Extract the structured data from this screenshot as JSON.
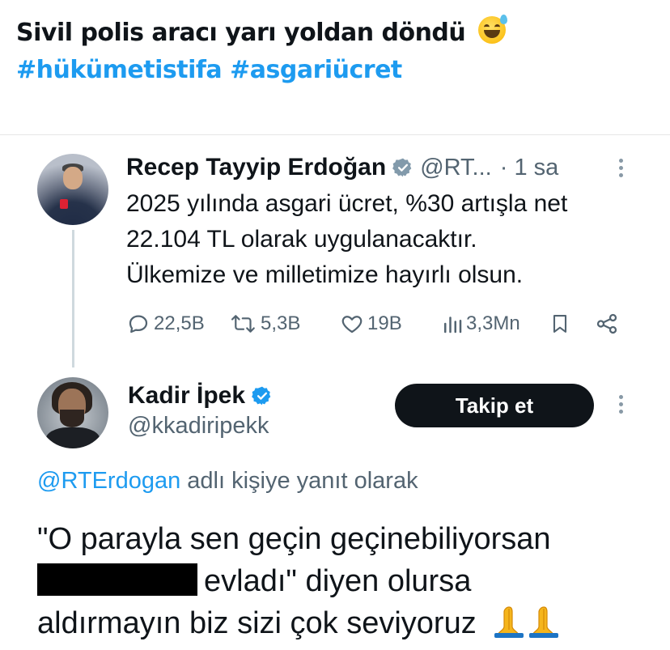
{
  "post": {
    "text": "Sivil polis aracı yarı yoldan döndü",
    "emoji": "grinning-face-with-sweat",
    "hashtags": "#hükümetistifa #asgariücret"
  },
  "quoted_tweet": {
    "author": "Recep Tayyip Erdoğan",
    "handle": "@RT...",
    "time": "· 1 sa",
    "lines": [
      "2025 yılında asgari ücret, %30 artışla net",
      "22.104 TL olarak uygulanacaktır.",
      "Ülkemize ve milletimize hayırlı olsun."
    ],
    "stats": {
      "replies": "22,5B",
      "reposts": "5,3B",
      "likes": "19B",
      "views": "3,3Mn"
    }
  },
  "reply": {
    "author": "Kadir İpek",
    "handle": "@kkadiripekk",
    "follow_label": "Takip et",
    "reply_to_mention": "@RTErdogan",
    "reply_to_suffix": " adlı kişiye yanıt olarak",
    "lines": [
      "\"O parayla sen geçin geçinebiliyorsan",
      "evladı\" diyen olursa",
      "aldırmayın biz sizi çok seviyoruz"
    ],
    "emoji": "folded-hands x2"
  },
  "colors": {
    "hashtag": "#1d9bf0",
    "text": "#0f1419",
    "secondary": "#536471",
    "follow_bg": "#0f1419"
  }
}
